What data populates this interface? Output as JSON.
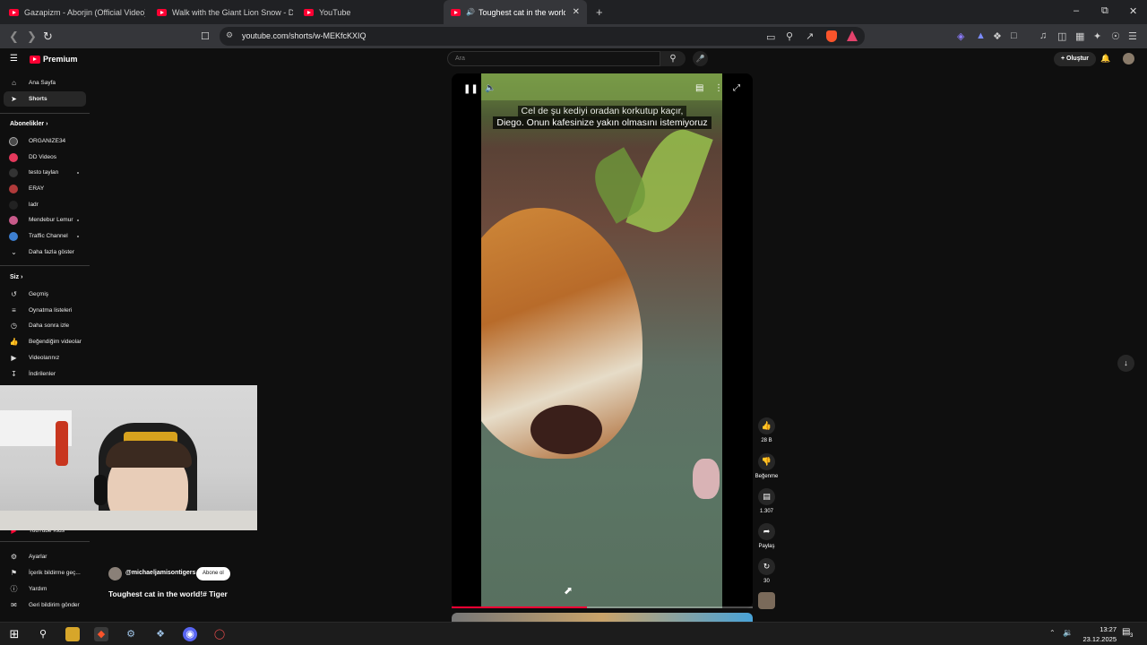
{
  "browser": {
    "tabs": [
      {
        "label": "Gazapizm - Aborjin (Official Video) -"
      },
      {
        "label": "Walk with the Giant Lion Snow - Dea"
      },
      {
        "label": "YouTube"
      },
      {
        "label": "Toughest cat in the world!# Ti"
      }
    ],
    "url": "youtube.com/shorts/w-MEKfcKXIQ"
  },
  "youtube": {
    "logo_text": "Premium",
    "search_placeholder": "Ara",
    "create_label": "Oluştur"
  },
  "sidebar": {
    "main": [
      {
        "label": "Ana Sayfa",
        "icon": "home-icon"
      },
      {
        "label": "Shorts",
        "icon": "shorts-icon"
      }
    ],
    "subscriptions_header": "Abonelikler",
    "subscriptions": [
      {
        "label": "ORGANIZE34"
      },
      {
        "label": "DD Videos"
      },
      {
        "label": "testo taylan"
      },
      {
        "label": "ERAY"
      },
      {
        "label": "ladr"
      },
      {
        "label": "Mendebur Lemur"
      },
      {
        "label": "Traffic Channel"
      }
    ],
    "show_more": "Daha fazla göster",
    "you_header": "Siz",
    "you": [
      {
        "label": "Geçmiş"
      },
      {
        "label": "Oynatma listeleri"
      },
      {
        "label": "Daha sonra izle"
      },
      {
        "label": "Beğendiğim videolar"
      },
      {
        "label": "Videolarınız"
      },
      {
        "label": "İndirilenler"
      }
    ],
    "kids": "YouTube Kids",
    "bottom": [
      {
        "label": "Ayarlar"
      },
      {
        "label": "İçerik bildirme geç..."
      },
      {
        "label": "Yardım"
      },
      {
        "label": "Geri bildirim gönder"
      }
    ]
  },
  "player": {
    "caption_line1": "Cel de şu kediyi oradan korkutup kaçır,",
    "caption_line2": "Diego.  Onun kafesinize yakın olmasını istemiyoruz",
    "progress": 0.45
  },
  "actions": {
    "likes": "28 B",
    "dislike_label": "Beğenme",
    "comments": "1.307",
    "share_label": "Paylaş",
    "remix_count": "30"
  },
  "short": {
    "channel": "@michaeljamisontigers",
    "subscribe_label": "Abone ol",
    "title": "Toughest cat in the world!# Tiger"
  },
  "taskbar": {
    "time": "13:27",
    "date": "23.12.2025",
    "notification_count": "3"
  }
}
